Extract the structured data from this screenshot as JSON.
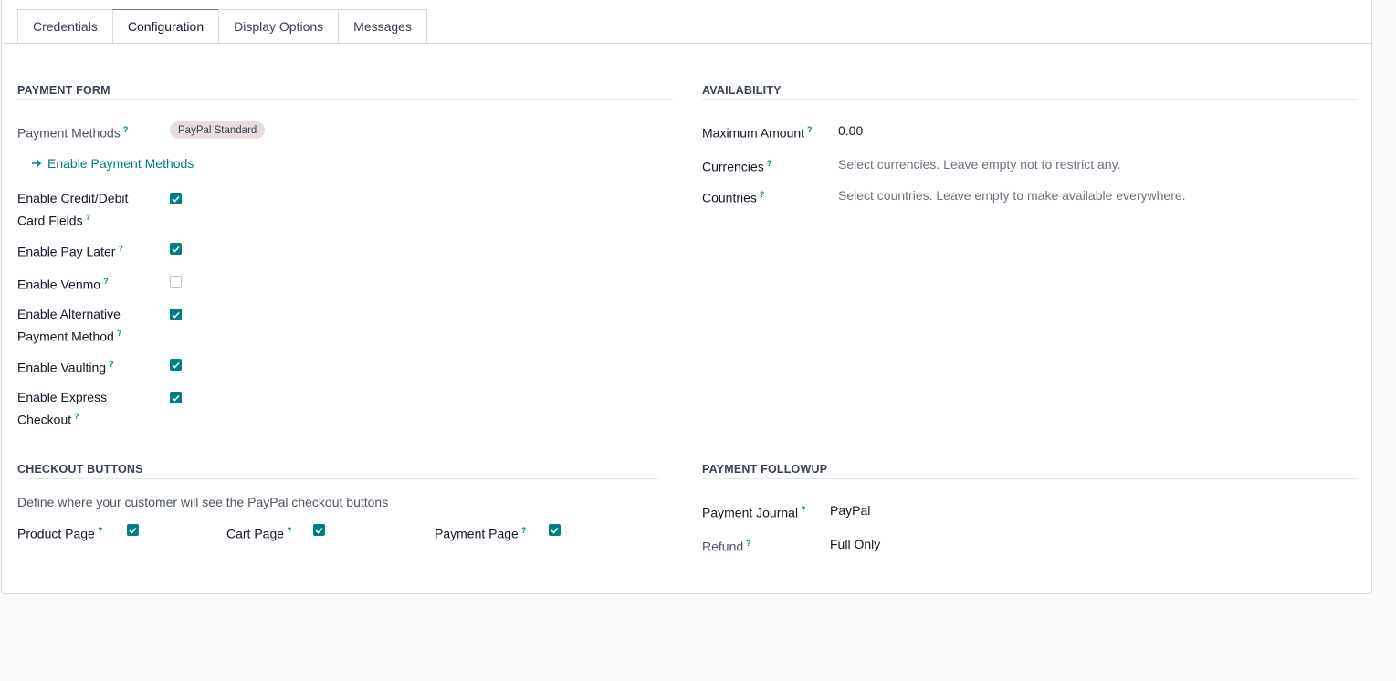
{
  "tabs": [
    {
      "label": "Credentials"
    },
    {
      "label": "Configuration"
    },
    {
      "label": "Display Options"
    },
    {
      "label": "Messages"
    }
  ],
  "payment_form": {
    "title": "PAYMENT FORM",
    "payment_methods_label": "Payment Methods",
    "payment_method_tag": "PayPal Standard",
    "enable_methods_link": "Enable Payment Methods",
    "options": [
      {
        "line1": "Enable Credit/Debit",
        "line2": "Card Fields",
        "checked": true
      },
      {
        "line1": "Enable Pay Later",
        "line2": "",
        "checked": true
      },
      {
        "line1": "Enable Venmo",
        "line2": "",
        "checked": false
      },
      {
        "line1": "Enable Alternative",
        "line2": "Payment Method",
        "checked": true
      },
      {
        "line1": "Enable Vaulting",
        "line2": "",
        "checked": true
      },
      {
        "line1": "Enable Express",
        "line2": "Checkout",
        "checked": true
      }
    ]
  },
  "availability": {
    "title": "AVAILABILITY",
    "max_amount_label": "Maximum Amount",
    "max_amount_value": "0.00",
    "currencies_label": "Currencies",
    "currencies_placeholder": "Select currencies. Leave empty not to restrict any.",
    "countries_label": "Countries",
    "countries_placeholder": "Select countries. Leave empty to make available everywhere."
  },
  "checkout_buttons": {
    "title": "CHECKOUT BUTTONS",
    "description": "Define where your customer will see the PayPal checkout buttons",
    "product_page_label": "Product Page",
    "cart_page_label": "Cart Page",
    "payment_page_label": "Payment Page"
  },
  "payment_followup": {
    "title": "PAYMENT FOLLOWUP",
    "journal_label": "Payment Journal",
    "journal_value": "PayPal",
    "refund_label": "Refund",
    "refund_value": "Full Only"
  },
  "help_mark": "?",
  "colors": {
    "accent": "#017e84",
    "tag_bg": "#e9dcdf"
  }
}
